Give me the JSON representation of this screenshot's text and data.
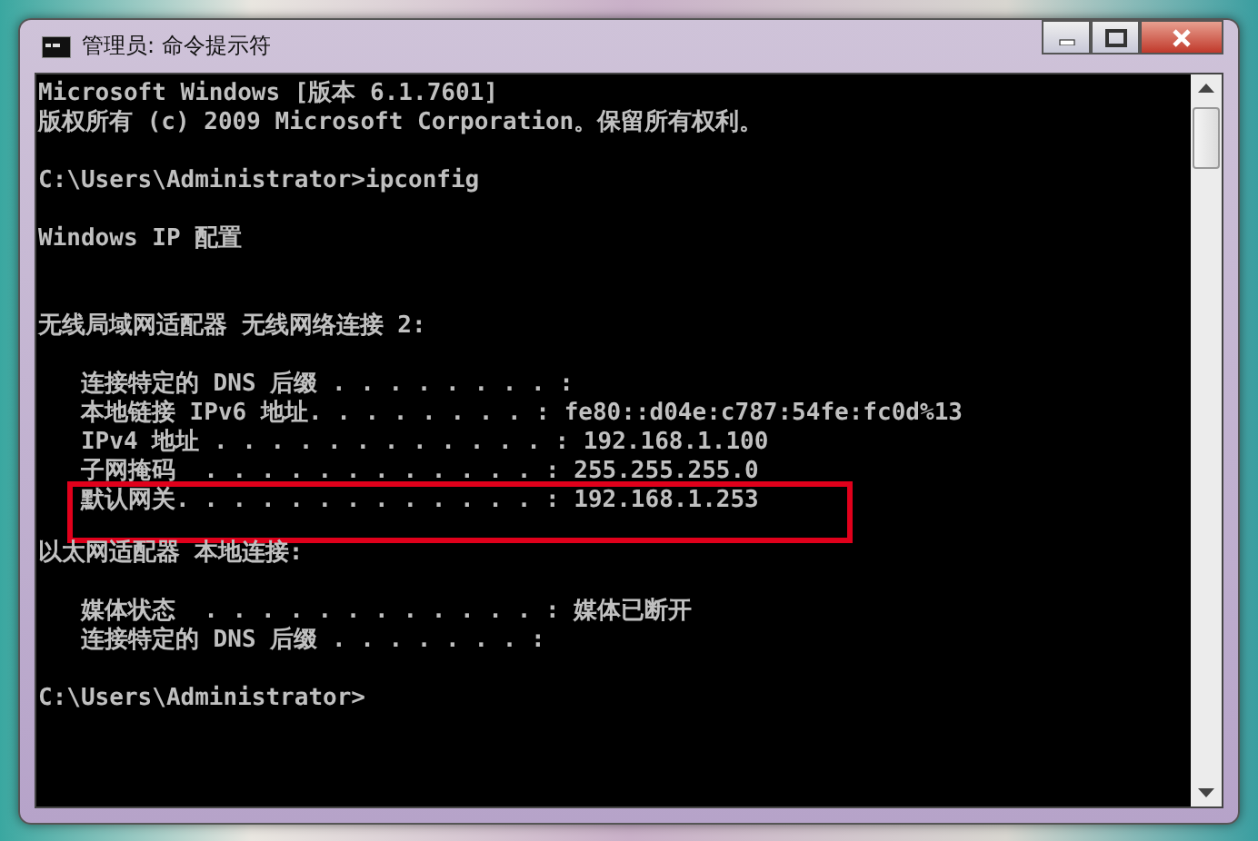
{
  "window": {
    "title": "管理员: 命令提示符"
  },
  "console": {
    "lines": [
      {
        "kind": "text",
        "text": "Microsoft Windows [版本 6.1.7601]",
        "highlighted": false
      },
      {
        "kind": "text",
        "text": "版权所有 (c) 2009 Microsoft Corporation。保留所有权利。",
        "highlighted": false
      },
      {
        "kind": "blank"
      },
      {
        "kind": "text",
        "text": "C:\\Users\\Administrator>ipconfig",
        "highlighted": false
      },
      {
        "kind": "blank"
      },
      {
        "kind": "text",
        "text": "Windows IP 配置",
        "highlighted": false
      },
      {
        "kind": "blank"
      },
      {
        "kind": "blank"
      },
      {
        "kind": "text",
        "text": "无线局域网适配器 无线网络连接 2:",
        "highlighted": false
      },
      {
        "kind": "blank"
      },
      {
        "kind": "text",
        "text": "   连接特定的 DNS 后缀 . . . . . . . . :",
        "highlighted": false
      },
      {
        "kind": "text",
        "text": "   本地链接 IPv6 地址. . . . . . . . : fe80::d04e:c787:54fe:fc0d%13",
        "highlighted": false
      },
      {
        "kind": "text",
        "text": "   IPv4 地址 . . . . . . . . . . . . : 192.168.1.100",
        "highlighted": false
      },
      {
        "kind": "text",
        "text": "   子网掩码  . . . . . . . . . . . . : 255.255.255.0",
        "highlighted": false
      },
      {
        "kind": "text",
        "text": "   默认网关. . . . . . . . . . . . . : 192.168.1.253",
        "highlighted": true
      },
      {
        "kind": "text",
        "text": "以太网适配器 本地连接:",
        "highlighted": false
      },
      {
        "kind": "blank"
      },
      {
        "kind": "text",
        "text": "   媒体状态  . . . . . . . . . . . . : 媒体已断开",
        "highlighted": false
      },
      {
        "kind": "text",
        "text": "   连接特定的 DNS 后缀 . . . . . . . :",
        "highlighted": false
      },
      {
        "kind": "blank"
      },
      {
        "kind": "text",
        "text": "C:\\Users\\Administrator>",
        "highlighted": false
      }
    ]
  }
}
